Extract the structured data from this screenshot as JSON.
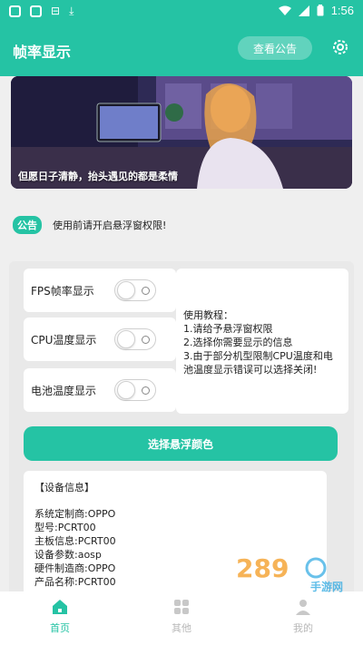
{
  "status_bar": {
    "time": "1:56"
  },
  "header": {
    "title": "帧率显示",
    "notice_button": "查看公告"
  },
  "banner": {
    "caption": "但愿日子清静，抬头遇见的都是柔情"
  },
  "notice": {
    "tag": "公告",
    "text": "使用前请开启悬浮窗权限!"
  },
  "toggles": [
    {
      "label": "FPS帧率显示",
      "on": false
    },
    {
      "label": "CPU温度显示",
      "on": false
    },
    {
      "label": "电池温度显示",
      "on": false
    }
  ],
  "tutorial": {
    "lines": [
      "使用教程：",
      "1.请给予悬浮窗权限",
      "2.选择你需要显示的信息",
      "3.由于部分机型限制CPU温度和电",
      "池温度显示错误可以选择关闭!"
    ]
  },
  "color_button": "选择悬浮颜色",
  "device": {
    "title": "【设备信息】",
    "lines": [
      "系统定制商:OPPO",
      "型号:PCRT00",
      "主板信息:PCRT00",
      "设备参数:aosp",
      "硬件制造商:OPPO",
      "产品名称:PCRT00"
    ]
  },
  "nav": [
    {
      "label": "首页",
      "icon": "home-icon",
      "active": true
    },
    {
      "label": "其他",
      "icon": "grid-icon",
      "active": false
    },
    {
      "label": "我的",
      "icon": "profile-icon",
      "active": false
    }
  ],
  "watermark": "手游网",
  "colors": {
    "accent": "#25c3a4",
    "background": "#efefef"
  }
}
